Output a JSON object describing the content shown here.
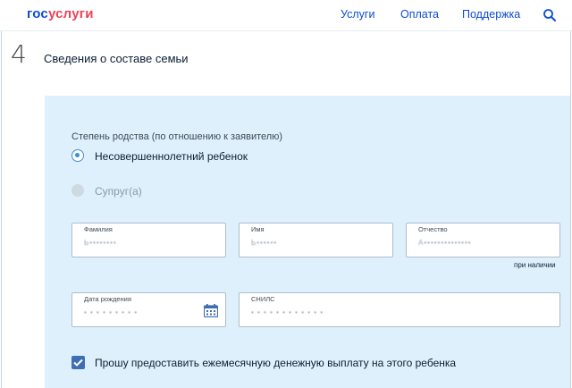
{
  "header": {
    "logo_part1": "гос",
    "logo_part2": "услуги",
    "nav": [
      "Услуги",
      "Оплата",
      "Поддержка"
    ],
    "search_icon": "search-icon"
  },
  "colors": {
    "brand_blue": "#0d4cd3",
    "brand_red": "#ee3f58",
    "panel_bg": "#def0fb",
    "checkbox": "#3e6fb3"
  },
  "step": {
    "number": "4",
    "title": "Сведения о составе семьи"
  },
  "relation": {
    "label": "Степень родства (по отношению к заявителю)",
    "options": [
      {
        "label": "Несовершеннолетний ребенок",
        "selected": true
      },
      {
        "label": "Супруг(а)",
        "selected": false,
        "disabled": true
      }
    ]
  },
  "fields": {
    "surname": {
      "label": "Фамилия",
      "value": "Ь••••••••"
    },
    "name": {
      "label": "Имя",
      "value": "Ь••••••"
    },
    "patronymic": {
      "label": "Отчество",
      "value": "А••••••••••••••"
    },
    "patronymic_hint": "при наличии",
    "birth_date": {
      "label": "Дата рождения",
      "value": "• • • • • • • • •"
    },
    "snils": {
      "label": "СНИЛС",
      "value": "• • • • • • • • • • • •"
    }
  },
  "monthly_payment": {
    "checked": true,
    "label": "Прошу предоставить ежемесячную денежную выплату на этого ребенка"
  }
}
